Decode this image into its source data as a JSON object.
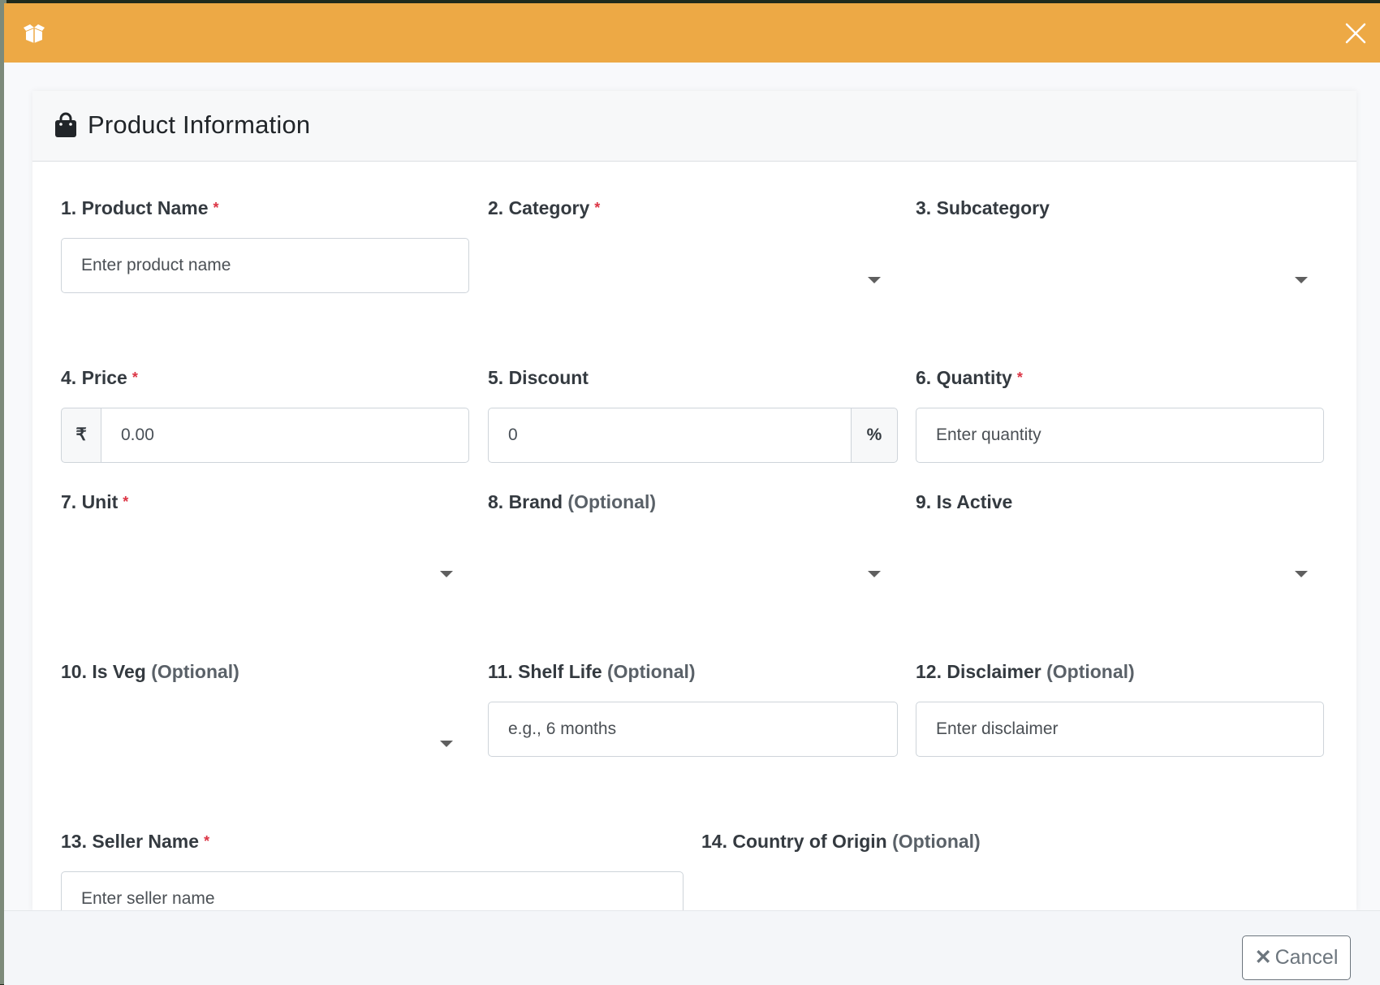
{
  "header": {
    "icon": "box-open-icon",
    "close_icon": "close-icon",
    "accent": "#eda945"
  },
  "card": {
    "title": "Product Information",
    "icon": "shopping-bag-icon"
  },
  "fields": {
    "product_name": {
      "label": "1. Product Name",
      "placeholder": "Enter product name",
      "required": "*"
    },
    "category": {
      "label": "2. Category",
      "required": "*"
    },
    "subcategory": {
      "label": "3. Subcategory"
    },
    "price": {
      "label": "4. Price",
      "required": "*",
      "prefix": "₹",
      "value": "0.00"
    },
    "discount": {
      "label": "5. Discount",
      "value": "0",
      "suffix": "%"
    },
    "quantity": {
      "label": "6. Quantity",
      "required": "*",
      "placeholder": "Enter quantity"
    },
    "unit": {
      "label": "7. Unit",
      "required": "*"
    },
    "brand": {
      "label": "8. Brand",
      "optional": "(Optional)"
    },
    "is_active": {
      "label": "9. Is Active"
    },
    "is_veg": {
      "label": "10. Is Veg",
      "optional": "(Optional)"
    },
    "shelf_life": {
      "label": "11. Shelf Life",
      "optional": "(Optional)",
      "placeholder": "e.g., 6 months"
    },
    "disclaimer": {
      "label": "12. Disclaimer",
      "optional": "(Optional)",
      "placeholder": "Enter disclaimer"
    },
    "seller_name": {
      "label": "13. Seller Name",
      "required": "*",
      "placeholder": "Enter seller name"
    },
    "country_of_origin": {
      "label": "14. Country of Origin",
      "optional": "(Optional)"
    }
  },
  "footer": {
    "cancel_label": "Cancel",
    "cancel_icon": "times-icon"
  }
}
